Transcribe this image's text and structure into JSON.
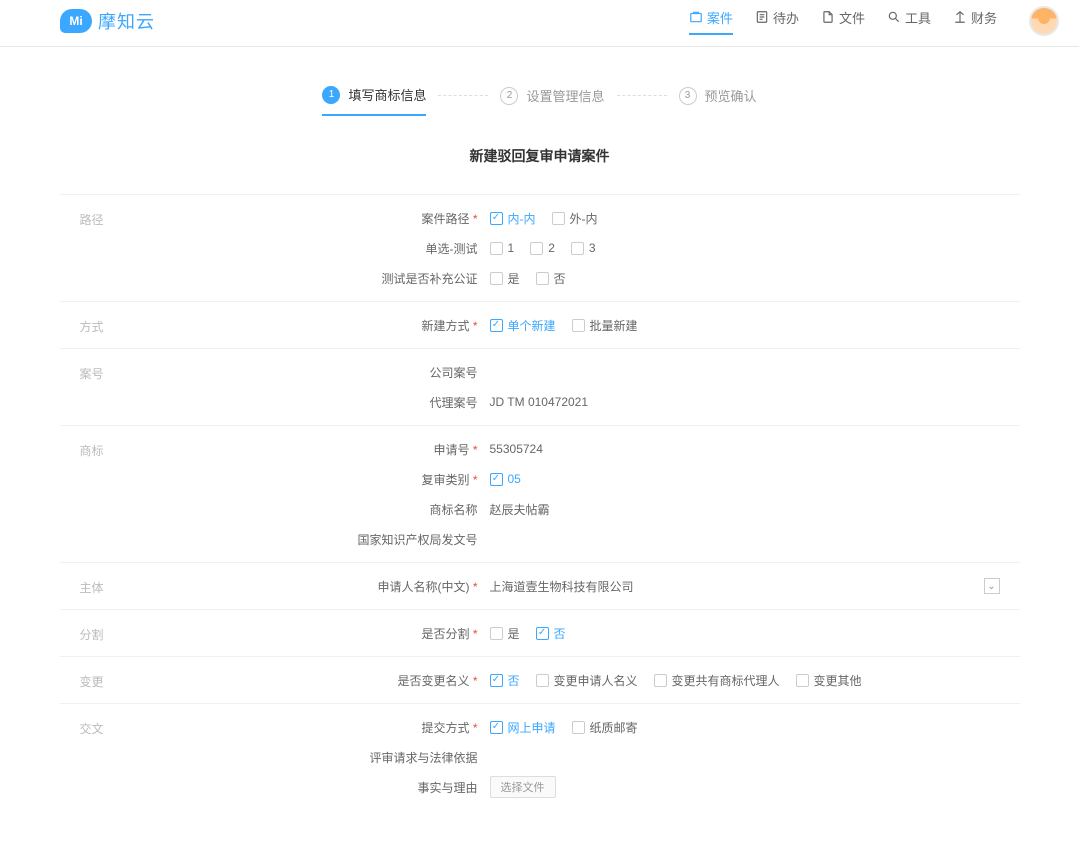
{
  "logo": {
    "text": "摩知云",
    "badge": "Mi"
  },
  "nav": {
    "cases": "案件",
    "todo": "待办",
    "files": "文件",
    "tools": "工具",
    "finance": "财务"
  },
  "steps": {
    "s1": "填写商标信息",
    "s2": "设置管理信息",
    "s3": "预览确认"
  },
  "page_title": "新建驳回复审申请案件",
  "sections": {
    "path": {
      "heading": "路径",
      "case_path_label": "案件路径",
      "case_path_opts": {
        "inner": "内-内",
        "outer": "外-内"
      },
      "single_test_label": "单选-测试",
      "single_test_opts": {
        "o1": "1",
        "o2": "2",
        "o3": "3"
      },
      "notarize_label": "测试是否补充公证",
      "yesno": {
        "yes": "是",
        "no": "否"
      }
    },
    "method": {
      "heading": "方式",
      "create_method_label": "新建方式",
      "opts": {
        "single": "单个新建",
        "batch": "批量新建"
      }
    },
    "caseno": {
      "heading": "案号",
      "company_label": "公司案号",
      "agent_label": "代理案号",
      "agent_value": "JD TM 010472021"
    },
    "trademark": {
      "heading": "商标",
      "app_no_label": "申请号",
      "app_no_value": "55305724",
      "review_cat_label": "复审类别",
      "review_cat_value": "05",
      "tm_name_label": "商标名称",
      "tm_name_value": "赵辰夫帖霸",
      "cnipa_label": "国家知识产权局发文号"
    },
    "subject": {
      "heading": "主体",
      "applicant_label": "申请人名称(中文)",
      "applicant_value": "上海道壹生物科技有限公司"
    },
    "split": {
      "heading": "分割",
      "label": "是否分割",
      "yesno": {
        "yes": "是",
        "no": "否"
      }
    },
    "change": {
      "heading": "变更",
      "label": "是否变更名义",
      "opts": {
        "no": "否",
        "applicant": "变更申请人名义",
        "coagent": "变更共有商标代理人",
        "other": "变更其他"
      }
    },
    "submit": {
      "heading": "交文",
      "method_label": "提交方式",
      "opts": {
        "online": "网上申请",
        "paper": "纸质邮寄"
      },
      "review_basis_label": "评审请求与法律依据",
      "facts_label": "事实与理由",
      "select_file": "选择文件"
    }
  }
}
